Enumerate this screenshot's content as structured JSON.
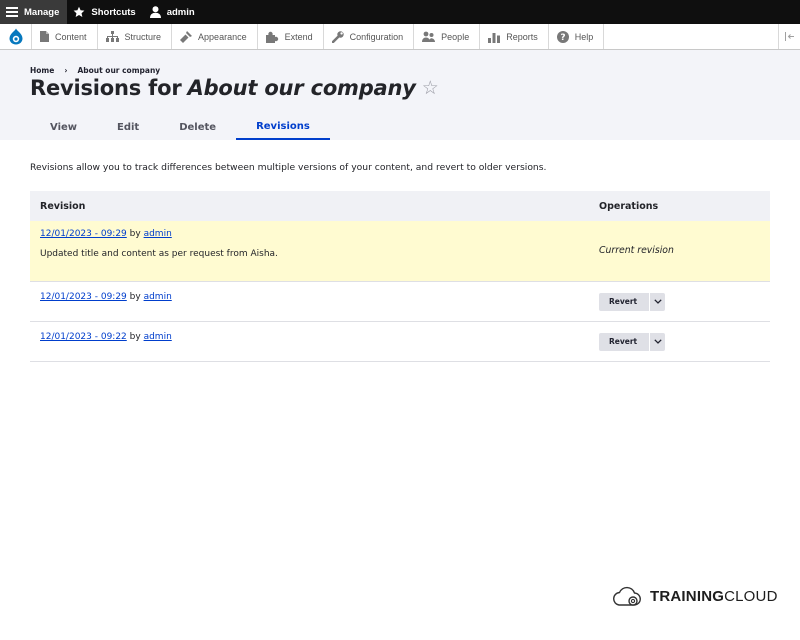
{
  "toolbar": {
    "manage": "Manage",
    "shortcuts": "Shortcuts",
    "user": "admin"
  },
  "admin_menu": [
    {
      "label": "Content",
      "icon": "content-icon"
    },
    {
      "label": "Structure",
      "icon": "structure-icon"
    },
    {
      "label": "Appearance",
      "icon": "appearance-icon"
    },
    {
      "label": "Extend",
      "icon": "extend-icon"
    },
    {
      "label": "Configuration",
      "icon": "configuration-icon"
    },
    {
      "label": "People",
      "icon": "people-icon"
    },
    {
      "label": "Reports",
      "icon": "reports-icon"
    },
    {
      "label": "Help",
      "icon": "help-icon"
    }
  ],
  "breadcrumb": {
    "home": "Home",
    "separator": "›",
    "current": "About our company"
  },
  "page": {
    "title_prefix": "Revisions for",
    "title_node": "About our company",
    "star": "☆"
  },
  "tabs": [
    {
      "label": "View",
      "active": false
    },
    {
      "label": "Edit",
      "active": false
    },
    {
      "label": "Delete",
      "active": false
    },
    {
      "label": "Revisions",
      "active": true
    }
  ],
  "intro": "Revisions allow you to track differences between multiple versions of your content, and revert to older versions.",
  "table": {
    "col_revision": "Revision",
    "col_operations": "Operations",
    "rows": [
      {
        "date": "12/01/2023 - 09:29",
        "by": "by",
        "author": "admin",
        "log": "Updated title and content as per request from Aisha.",
        "operation": "Current revision"
      },
      {
        "date": "12/01/2023 - 09:29",
        "by": "by",
        "author": "admin",
        "operation": "Revert"
      },
      {
        "date": "12/01/2023 - 09:22",
        "by": "by",
        "author": "admin",
        "operation": "Revert"
      }
    ]
  },
  "brand": {
    "part1": "TRAINING",
    "part2": "CLOUD"
  },
  "colors": {
    "link": "#003ecc",
    "current_row": "#fffbd1",
    "toolbar": "#0f0f0f",
    "drupal_blue": "#0678be"
  }
}
